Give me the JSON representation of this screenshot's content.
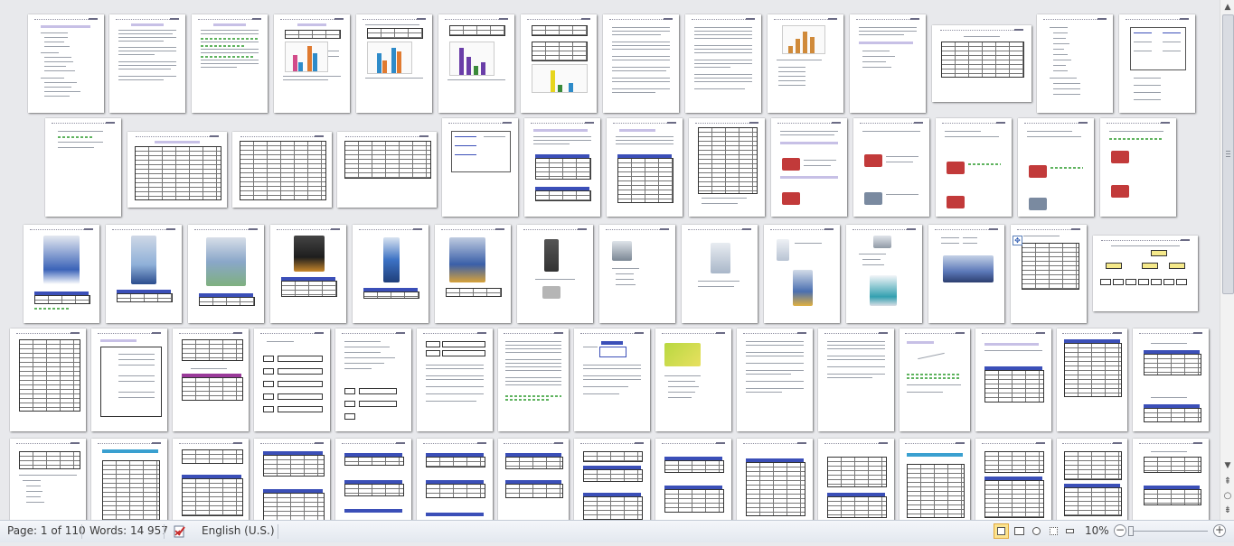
{
  "status": {
    "page_info": "Page: 1 of 110",
    "words": "Words: 14 957",
    "language": "English (U.S.)",
    "zoom": "10%",
    "zoom_out": "−",
    "zoom_in": "+"
  },
  "icons": {
    "spellcheck": "spellcheck-icon",
    "print_layout": "print-layout-view-icon",
    "full_screen": "full-screen-reading-icon",
    "web_layout": "web-layout-icon",
    "outline": "outline-view-icon",
    "draft": "draft-view-icon"
  },
  "colors": {
    "active_view": "#fbe38f",
    "title_highlight": "#c7c0e6",
    "table_header": "#3b4fb8"
  }
}
